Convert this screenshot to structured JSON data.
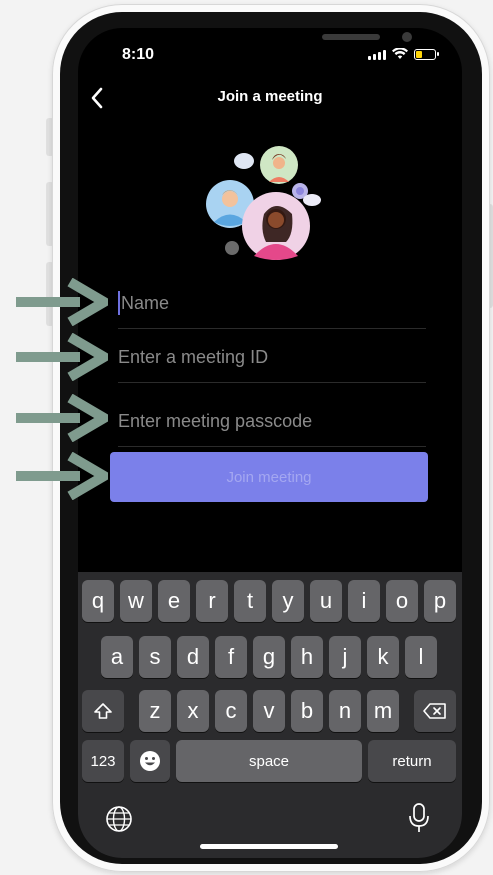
{
  "status_bar": {
    "time": "8:10"
  },
  "nav": {
    "title": "Join a meeting"
  },
  "form": {
    "name_placeholder": "Name",
    "meeting_id_placeholder": "Enter a meeting ID",
    "passcode_placeholder": "Enter meeting passcode",
    "join_label": "Join meeting"
  },
  "keyboard": {
    "row1": [
      "q",
      "w",
      "e",
      "r",
      "t",
      "y",
      "u",
      "i",
      "o",
      "p"
    ],
    "row2": [
      "a",
      "s",
      "d",
      "f",
      "g",
      "h",
      "j",
      "k",
      "l"
    ],
    "row3": [
      "z",
      "x",
      "c",
      "v",
      "b",
      "n",
      "m"
    ],
    "numbers_label": "123",
    "space_label": "space",
    "return_label": "return"
  },
  "icons": [
    "back-chevron-icon",
    "shift-icon",
    "backspace-icon",
    "emoji-icon",
    "globe-icon",
    "microphone-icon",
    "arrow-icon"
  ],
  "colors": {
    "accent": "#7b80ea",
    "arrow": "#7f9b8e",
    "caret": "#6f71e0"
  }
}
